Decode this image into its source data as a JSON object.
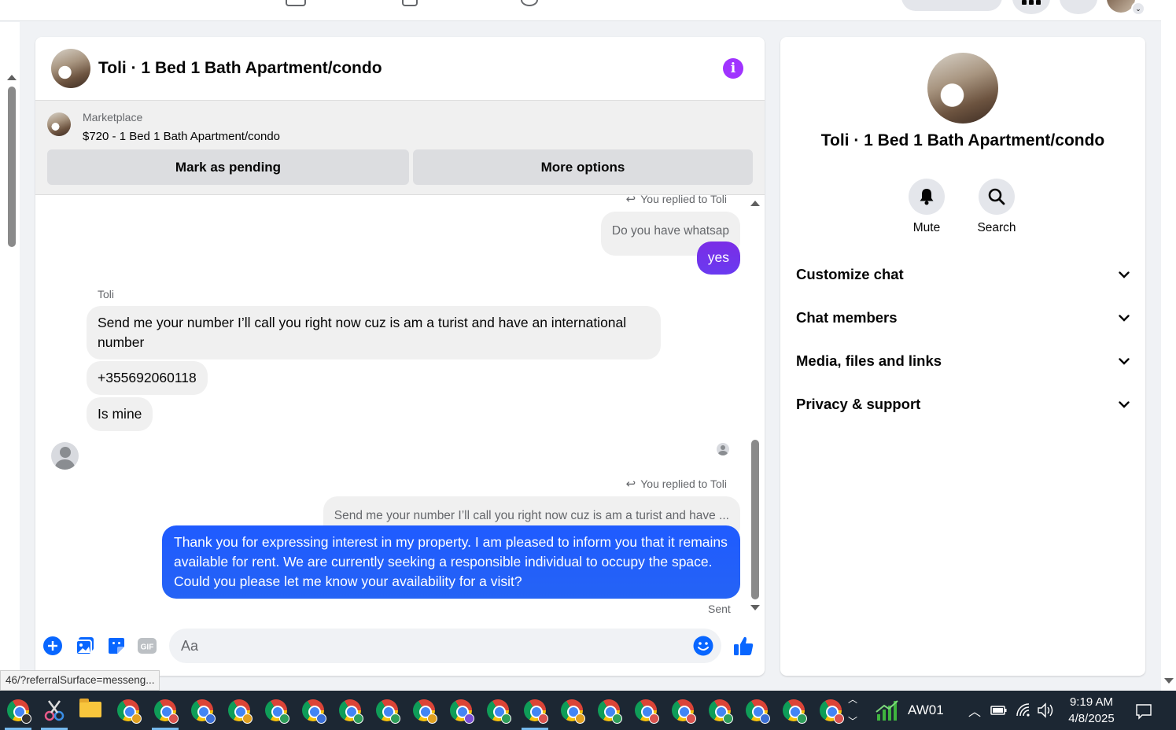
{
  "window": {
    "link_preview": "46/?referralSurface=messeng..."
  },
  "chat": {
    "title": "Toli · 1 Bed 1 Bath Apartment/condo",
    "marketplace_label": "Marketplace",
    "listing": "$720 - 1 Bed 1 Bath Apartment/condo",
    "mark_pending_label": "Mark as pending",
    "more_options_label": "More options",
    "messages": {
      "reply_note_1": "You replied to Toli",
      "quote_1": "Do you have whatsap",
      "out_1": "yes",
      "sender_name": "Toli",
      "in_1": "Send me your number I’ll call you right now cuz is am a turist and have an international number",
      "in_2": "+355692060118",
      "in_3": "Is mine",
      "reply_note_2": "You replied to Toli",
      "quote_2": "Send me your number I’ll call you right now cuz is am a turist and have ...",
      "out_2": "Thank you for expressing interest in my property. I am pleased to inform you that it remains available for rent. We are currently seeking a responsible individual to occupy the space. Could you please let me know your availability for a visit?",
      "status": "Sent"
    },
    "composer": {
      "placeholder": "Aa"
    },
    "colors": {
      "outgoing_gradient_top": "#8a2be2",
      "outgoing_blue": "#1f5bff",
      "accent": "#0866ff",
      "info": "#a033ff"
    }
  },
  "info_panel": {
    "title": "Toli · 1 Bed 1 Bath Apartment/condo",
    "mute_label": "Mute",
    "search_label": "Search",
    "sections": [
      "Customize chat",
      "Chat members",
      "Media, files and links",
      "Privacy & support"
    ]
  },
  "taskbar": {
    "network_name": "AW01",
    "time": "9:19 AM",
    "date": "4/8/2025"
  }
}
